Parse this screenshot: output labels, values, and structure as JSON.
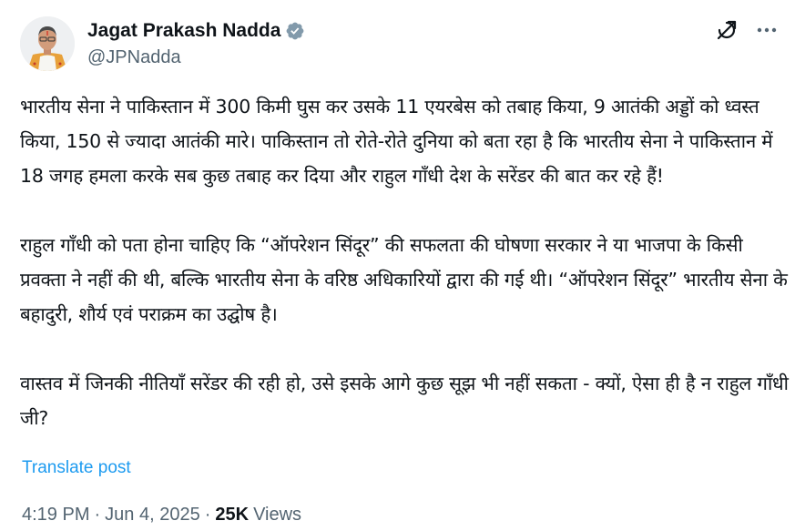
{
  "author": {
    "display_name": "Jagat Prakash Nadda",
    "handle": "@JPNadda",
    "verified": true,
    "avatar_icon": "profile-photo"
  },
  "actions": {
    "grok_icon": "grok-icon",
    "more_icon": "more-horizontal-icon"
  },
  "post": {
    "paragraphs": [
      "भारतीय सेना ने पाकिस्तान में 300 किमी घुस कर उसके 11 एयरबेस को तबाह किया, 9 आतंकी अड्डों को ध्वस्त किया, 150 से ज्यादा आतंकी मारे। पाकिस्तान तो रोते-रोते दुनिया को बता रहा है कि भारतीय सेना ने पाकिस्तान में 18 जगह हमला करके सब कुछ तबाह कर दिया और राहुल गाँधी देश के सरेंडर की बात कर रहे हैं!",
      "राहुल गाँधी को पता होना चाहिए कि “ऑपरेशन सिंदूर” की सफलता की घोषणा सरकार ने या भाजपा के किसी प्रवक्ता ने नहीं की थी, बल्कि भारतीय सेना के वरिष्ठ अधिकारियों द्वारा की गई थी। “ऑपरेशन सिंदूर” भारतीय सेना के बहादुरी, शौर्य एवं पराक्रम का उद्घोष है।",
      "वास्तव में जिनकी नीतियाँ सरेंडर की रही हो, उसे इसके आगे कुछ सूझ भी नहीं सकता - क्यों, ऐसा ही है न राहुल गाँधी जी?"
    ],
    "translate_label": "Translate post"
  },
  "meta": {
    "time": "4:19 PM",
    "separator": "·",
    "date": "Jun 4, 2025",
    "views_count": "25K",
    "views_label": "Views"
  },
  "colors": {
    "text": "#0f1419",
    "secondary": "#536471",
    "link": "#1d9bf0",
    "verified": "#829aab"
  }
}
